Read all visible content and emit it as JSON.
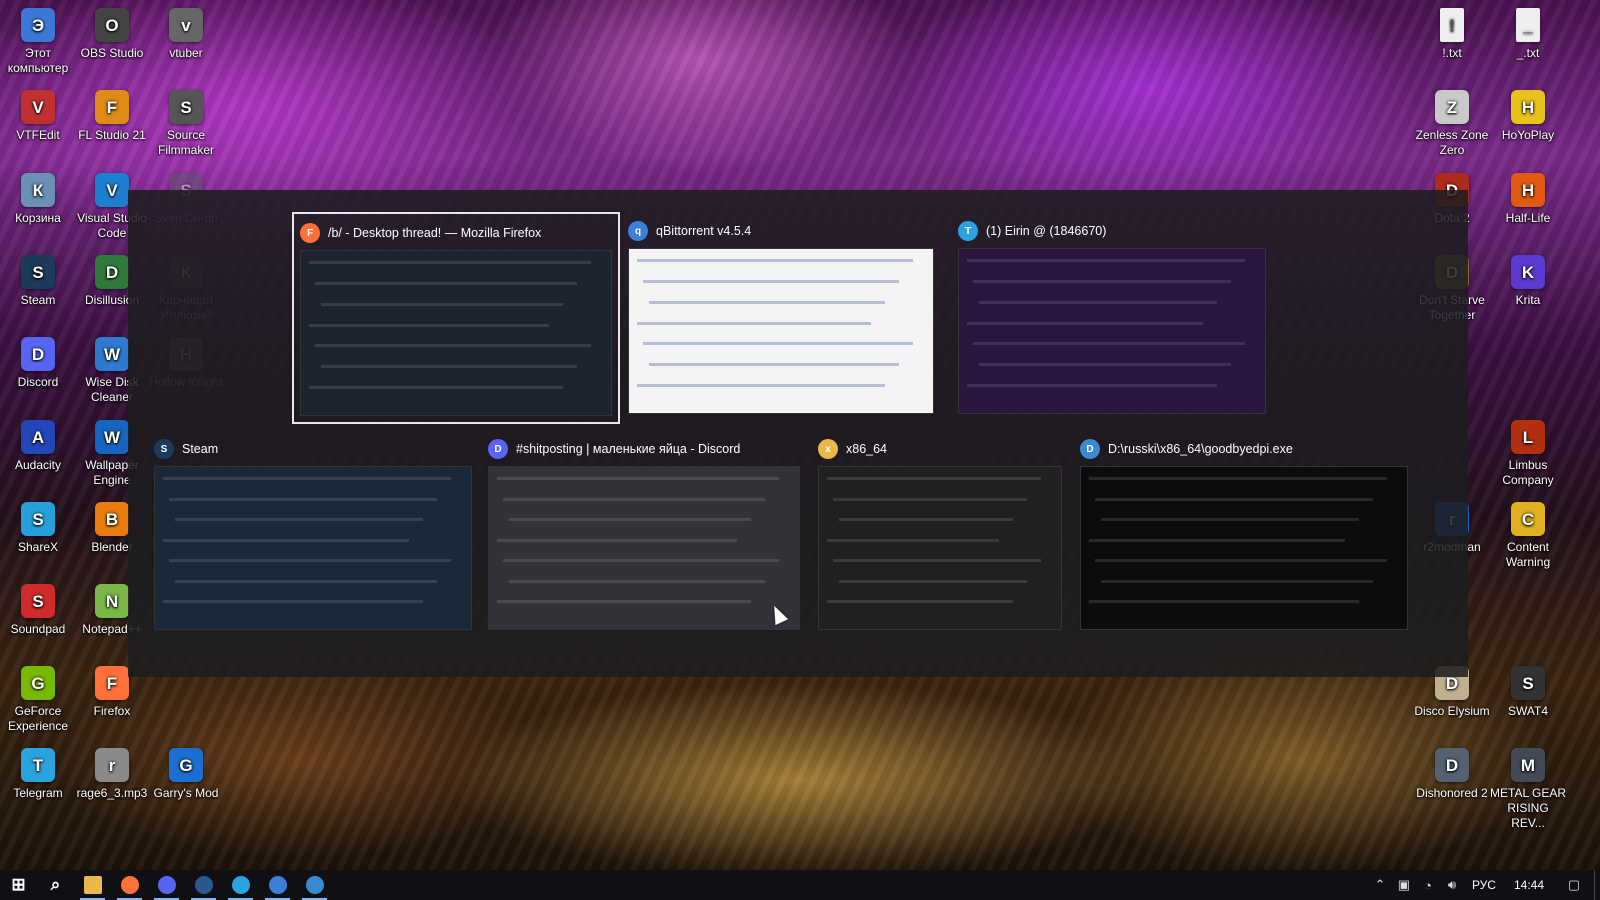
{
  "desktop": {
    "icons_left": [
      {
        "label": "Этот компьютер",
        "icon": "this-pc-icon",
        "color": "#3b78d8"
      },
      {
        "label": "OBS Studio",
        "icon": "obs-icon",
        "color": "#444444"
      },
      {
        "label": "vtuber",
        "icon": "vtuber-shortcut-icon",
        "color": "#666666"
      },
      {
        "label": "VTFEdit",
        "icon": "vtfedit-icon",
        "color": "#c03030"
      },
      {
        "label": "FL Studio 21",
        "icon": "fl-studio-icon",
        "color": "#e08a18"
      },
      {
        "label": "Source Filmmaker",
        "icon": "source-filmmaker-icon",
        "color": "#555555"
      },
      {
        "label": "Корзина",
        "icon": "recycle-bin-icon",
        "color": "#6b8fb5"
      },
      {
        "label": "Visual Studio Code",
        "icon": "vscode-icon",
        "color": "#1e7fd0"
      },
      {
        "label": "Sven Co-op",
        "icon": "sven-coop-icon",
        "color": "#555a66"
      },
      {
        "label": "Steam",
        "icon": "steam-icon",
        "color": "#1b3a5c"
      },
      {
        "label": "Disillusion",
        "icon": "disillusion-icon",
        "color": "#2f7a3a"
      },
      {
        "label": "Карнавал Иллюзий",
        "icon": "carnival-illusion-icon",
        "color": "#6a5a6a"
      },
      {
        "label": "Discord",
        "icon": "discord-icon",
        "color": "#5865f2"
      },
      {
        "label": "Wise Disk Cleaner",
        "icon": "wise-disk-cleaner-icon",
        "color": "#2f7ad0"
      },
      {
        "label": "Hollow Knight",
        "icon": "hollow-knight-icon",
        "color": "#777777"
      },
      {
        "label": "Audacity",
        "icon": "audacity-icon",
        "color": "#2346b8"
      },
      {
        "label": "Wallpaper Engine",
        "icon": "wallpaper-engine-icon",
        "color": "#1565c0"
      },
      {
        "label": "ShareX",
        "icon": "sharex-icon",
        "color": "#26a0da"
      },
      {
        "label": "Blender",
        "icon": "blender-icon",
        "color": "#e87d0d"
      },
      {
        "label": "Soundpad",
        "icon": "soundpad-icon",
        "color": "#d02a2a"
      },
      {
        "label": "Notepad++",
        "icon": "notepad-plus-plus-icon",
        "color": "#7ab648"
      },
      {
        "label": "GeForce Experience",
        "icon": "geforce-experience-icon",
        "color": "#76b900"
      },
      {
        "label": "Firefox",
        "icon": "firefox-icon",
        "color": "#ff7139"
      },
      {
        "label": "Telegram",
        "icon": "telegram-icon",
        "color": "#2aa3e0"
      },
      {
        "label": "rage6_3.mp3",
        "icon": "mp3-file-icon",
        "color": "#8a8a8a"
      },
      {
        "label": "Garry's Mod",
        "icon": "garrys-mod-icon",
        "color": "#1a6fd0"
      }
    ],
    "icons_right": [
      {
        "label": "!.txt",
        "icon": "text-file-icon",
        "color": "#eeeeee"
      },
      {
        "label": "_.txt",
        "icon": "text-file-icon",
        "color": "#eeeeee"
      },
      {
        "label": "Zenless Zone Zero",
        "icon": "zenless-zone-zero-icon",
        "color": "#c9c9c9"
      },
      {
        "label": "HoYoPlay",
        "icon": "hoyoplay-icon",
        "color": "#e8c21a"
      },
      {
        "label": "Dota 2",
        "icon": "dota2-icon",
        "color": "#b02a1e"
      },
      {
        "label": "Half-Life",
        "icon": "half-life-icon",
        "color": "#e25a12"
      },
      {
        "label": "Don't Starve Together",
        "icon": "dont-starve-together-icon",
        "color": "#8a6a3a"
      },
      {
        "label": "Krita",
        "icon": "krita-icon",
        "color": "#5a3ad0"
      },
      {
        "label": "Limbus Company",
        "icon": "limbus-company-icon",
        "color": "#b03010"
      },
      {
        "label": "r2modman",
        "icon": "r2modman-icon",
        "color": "#2060c0"
      },
      {
        "label": "Content Warning",
        "icon": "content-warning-icon",
        "color": "#e0b020"
      },
      {
        "label": "Disco Elysium",
        "icon": "disco-elysium-icon",
        "color": "#c0b090"
      },
      {
        "label": "SWAT4",
        "icon": "swat4-icon",
        "color": "#333333"
      },
      {
        "label": "Dishonored 2",
        "icon": "dishonored2-icon",
        "color": "#556070"
      },
      {
        "label": "METAL GEAR RISING REV...",
        "icon": "metal-gear-rising-icon",
        "color": "#444a55"
      }
    ]
  },
  "switcher": {
    "windows": [
      {
        "title": "/b/ - Desktop thread! — Mozilla Firefox",
        "icon": "firefox-icon",
        "icon_color": "#ff7139",
        "selected": true,
        "thumb_bg": "#1c2430"
      },
      {
        "title": "qBittorrent v4.5.4",
        "icon": "qbittorrent-icon",
        "icon_color": "#3b7fd6",
        "selected": false,
        "thumb_bg": "#f4f4f4"
      },
      {
        "title": "(1) Eirin @     (1846670)",
        "icon": "telegram-icon",
        "icon_color": "#2aa3e0",
        "selected": false,
        "thumb_bg": "#2a1440"
      },
      {
        "title": "Steam",
        "icon": "steam-icon",
        "icon_color": "#1b3a5c",
        "selected": false,
        "thumb_bg": "#1b2838"
      },
      {
        "title": "#shitposting | маленькие яйца - Discord",
        "icon": "discord-icon",
        "icon_color": "#5865f2",
        "selected": false,
        "thumb_bg": "#313338"
      },
      {
        "title": "x86_64",
        "icon": "folder-icon",
        "icon_color": "#e8b84a",
        "selected": false,
        "thumb_bg": "#202020"
      },
      {
        "title": "D:\\russki\\x86_64\\goodbyedpi.exe",
        "icon": "goodbyedpi-icon",
        "icon_color": "#3a8ad0",
        "selected": false,
        "thumb_bg": "#0c0c0c"
      }
    ]
  },
  "taskbar": {
    "apps": [
      {
        "name": "start-button",
        "icon": "windows-logo-icon",
        "color": "#ffffff",
        "running": false
      },
      {
        "name": "search-button",
        "icon": "search-icon",
        "color": "#ffffff",
        "running": false
      },
      {
        "name": "taskbar-explorer",
        "icon": "folder-icon",
        "color": "#e8b84a",
        "running": true
      },
      {
        "name": "taskbar-firefox",
        "icon": "firefox-icon",
        "color": "#ff7139",
        "running": true
      },
      {
        "name": "taskbar-discord",
        "icon": "discord-icon",
        "color": "#5865f2",
        "running": true
      },
      {
        "name": "taskbar-steam",
        "icon": "steam-icon",
        "color": "#2a5a8c",
        "running": true
      },
      {
        "name": "taskbar-telegram",
        "icon": "telegram-icon",
        "color": "#2aa3e0",
        "running": true
      },
      {
        "name": "taskbar-qbittorrent",
        "icon": "qbittorrent-icon",
        "color": "#3b7fd6",
        "running": true
      },
      {
        "name": "taskbar-goodbyedpi",
        "icon": "goodbyedpi-icon",
        "color": "#3a8ad0",
        "running": true
      }
    ],
    "tray": {
      "language": "РУС",
      "time": "14:44"
    }
  }
}
